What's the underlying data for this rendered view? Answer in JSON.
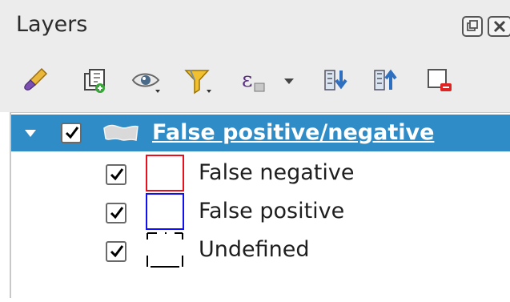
{
  "panel": {
    "title": "Layers",
    "float_icon": "float-window-icon",
    "close_icon": "close-icon"
  },
  "toolbar": {
    "buttons": [
      {
        "icon": "style-manager-icon"
      },
      {
        "icon": "add-group-icon"
      },
      {
        "icon": "manage-visibility-icon"
      },
      {
        "icon": "filter-legend-icon"
      },
      {
        "icon": "filter-by-expression-icon"
      },
      {
        "icon": "expand-all-icon"
      },
      {
        "icon": "collapse-all-icon"
      },
      {
        "icon": "remove-layer-icon"
      }
    ]
  },
  "tree": {
    "group": {
      "label": "False positive/negative",
      "checked": true,
      "expanded": true,
      "selected": true,
      "icon": "polygon-layer-icon"
    },
    "items": [
      {
        "label": "False negative",
        "checked": true,
        "color": "#e8101c"
      },
      {
        "label": "False positive",
        "checked": true,
        "color": "#1010f0"
      },
      {
        "label": "Undefined",
        "checked": true,
        "color": "#000000"
      }
    ]
  },
  "colors": {
    "selection": "#308cc6",
    "panel_bg": "#ececec"
  }
}
